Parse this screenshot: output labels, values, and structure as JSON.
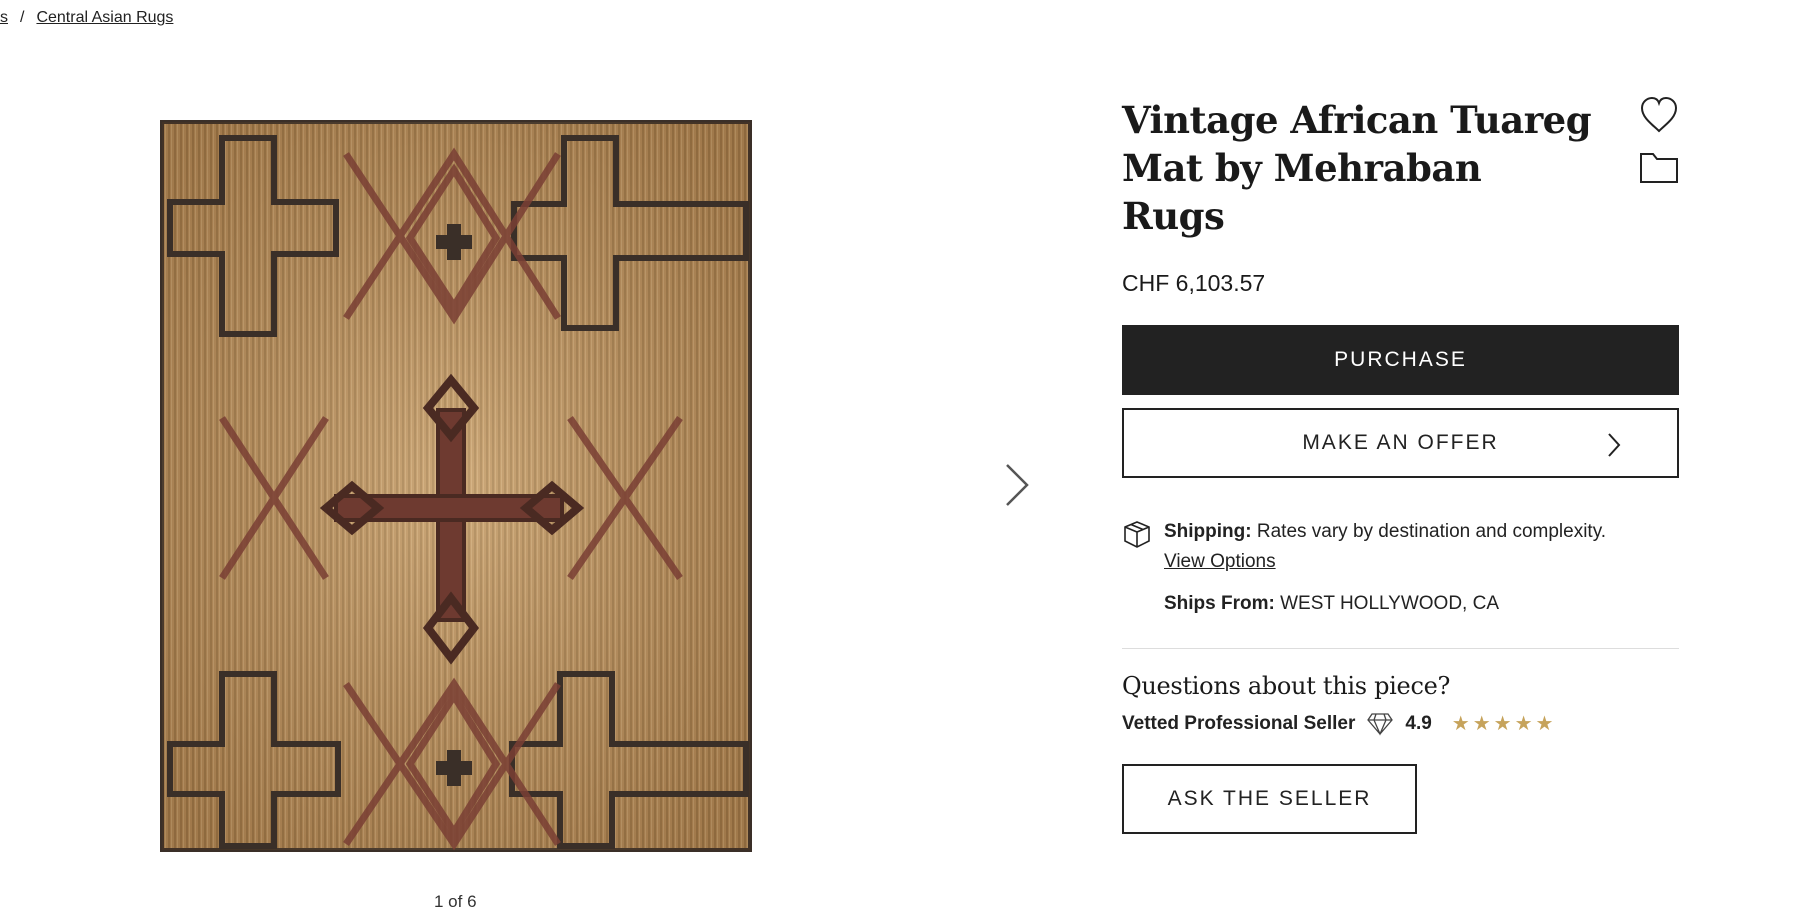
{
  "breadcrumb": {
    "partial": "s",
    "separator": "/",
    "current": "Central Asian Rugs"
  },
  "gallery": {
    "counter": "1 of 6",
    "next_icon": "chevron-right-icon"
  },
  "product": {
    "title": "Vintage African Tuareg Mat by Mehraban Rugs",
    "price": "CHF 6,103.57",
    "favorite_icon": "heart-icon",
    "collection_icon": "folder-icon"
  },
  "actions": {
    "purchase_label": "PURCHASE",
    "offer_label": "MAKE AN OFFER",
    "ask_label": "ASK THE SELLER"
  },
  "shipping": {
    "label": "Shipping:",
    "text": "Rates vary by destination and complexity.",
    "link": "View Options",
    "from_label": "Ships From:",
    "from_value": "WEST HOLLYWOOD, CA"
  },
  "seller": {
    "questions": "Questions about this piece?",
    "badge": "Vetted Professional Seller",
    "rating": "4.9",
    "stars": 5,
    "star_color": "#c6a35b"
  },
  "colors": {
    "primary_button": "#222222",
    "rug_base": "#b88d5a",
    "rug_motif_dark": "#3a2f28",
    "rug_motif_red": "#7a3f34"
  }
}
